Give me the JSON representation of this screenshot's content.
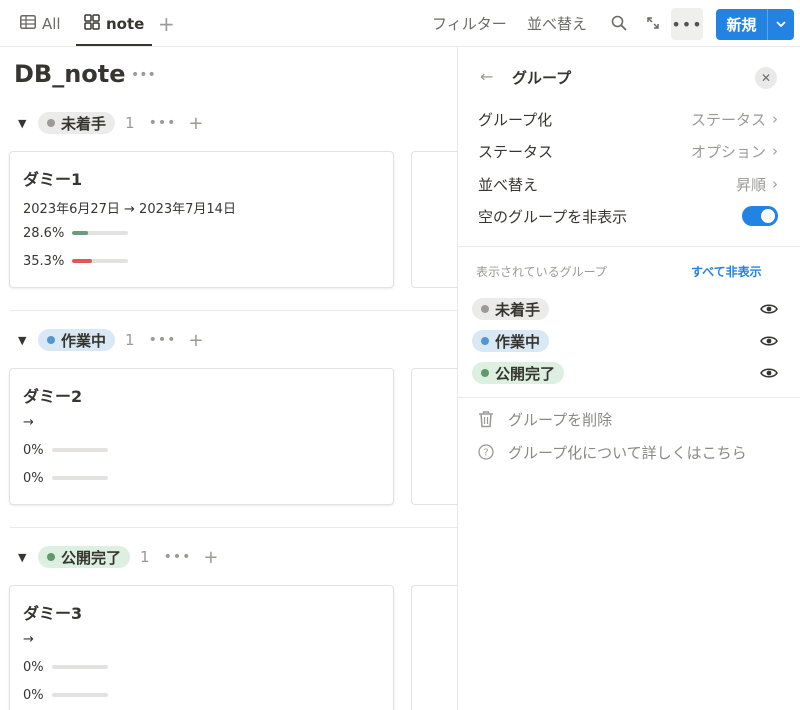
{
  "topbar": {
    "tabs": [
      {
        "label": "All",
        "icon": "table-icon"
      },
      {
        "label": "note",
        "icon": "board-icon"
      }
    ],
    "add_view": "+",
    "filter_label": "フィルター",
    "sort_label": "並べ替え",
    "new_label": "新規"
  },
  "page": {
    "title": "DB_note"
  },
  "groups": [
    {
      "label": "未着手",
      "count": "1",
      "color": "#9b9a97",
      "bg": "#ebebea",
      "card": {
        "title": "ダミー1",
        "date": "2023年6月27日 → 2023年7月14日",
        "progress": [
          {
            "text": "28.6%",
            "value": 0.286,
            "color": "#6c9a7f"
          },
          {
            "text": "35.3%",
            "value": 0.353,
            "color": "#e0575b"
          }
        ]
      }
    },
    {
      "label": "作業中",
      "count": "1",
      "color": "#4f96d2",
      "bg": "#d9e8f5",
      "card": {
        "title": "ダミー2",
        "date": "→",
        "progress": [
          {
            "text": "0%",
            "value": 0,
            "color": "#6c9a7f"
          },
          {
            "text": "0%",
            "value": 0,
            "color": "#e0575b"
          }
        ]
      }
    },
    {
      "label": "公開完了",
      "count": "1",
      "color": "#5f9a6b",
      "bg": "#dcefe0",
      "card": {
        "title": "ダミー3",
        "date": "→",
        "progress": [
          {
            "text": "0%",
            "value": 0,
            "color": "#6c9a7f"
          },
          {
            "text": "0%",
            "value": 0,
            "color": "#e0575b"
          }
        ]
      }
    }
  ],
  "panel": {
    "title": "グループ",
    "rows": [
      {
        "label": "グループ化",
        "value": "ステータス"
      },
      {
        "label": "ステータス",
        "value": "オプション"
      },
      {
        "label": "並べ替え",
        "value": "昇順"
      }
    ],
    "hide_empty_label": "空のグループを非表示",
    "hide_empty_on": true,
    "visible_groups_label": "表示されているグループ",
    "hide_all_label": "すべて非表示",
    "visible_groups": [
      {
        "label": "未着手",
        "color": "#9b9a97",
        "bg": "#ebebea"
      },
      {
        "label": "作業中",
        "color": "#4f96d2",
        "bg": "#d9e8f5"
      },
      {
        "label": "公開完了",
        "color": "#5f9a6b",
        "bg": "#dcefe0"
      }
    ],
    "delete_label": "グループを削除",
    "help_label": "グループ化について詳しくはこちら"
  }
}
